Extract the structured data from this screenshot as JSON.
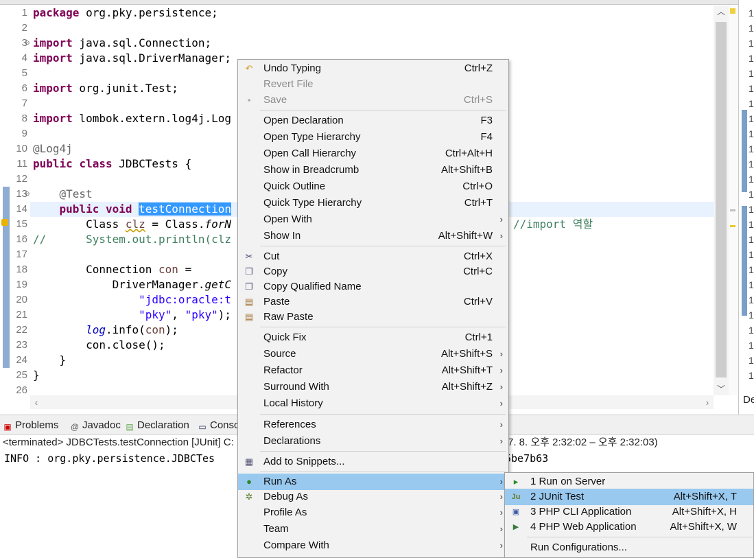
{
  "editor": {
    "line_numbers": [
      "1",
      "2",
      "3",
      "4",
      "5",
      "6",
      "7",
      "8",
      "9",
      "10",
      "11",
      "12",
      "13",
      "14",
      "15",
      "16",
      "17",
      "18",
      "19",
      "20",
      "21",
      "22",
      "23",
      "24",
      "25",
      "26"
    ],
    "code": {
      "l1_kw": "package",
      "l1_rest": " org.pky.persistence;",
      "l3_kw": "import",
      "l3_rest": " java.sql.Connection;",
      "l4_kw": "import",
      "l4_rest": " java.sql.DriverManager;",
      "l6_kw": "import",
      "l6_rest": " org.junit.Test;",
      "l8_kw": "import",
      "l8_rest": " lombok.extern.log4j.Log",
      "l10_ann": "@Log4j",
      "l11_kw1": "public",
      "l11_kw2": "class",
      "l11_rest": " JDBCTests {",
      "l13_ann": "@Test",
      "l14_kw1": "public",
      "l14_kw2": "void",
      "l14_sel": "testConnection",
      "l15_a": "Class ",
      "l15_b": "clz",
      "l15_c": " = Class.",
      "l15_d": "forN",
      "l15_comment": "//import 역할",
      "l16_comment_a": "//",
      "l16_comment_b": "System.out.println(clz",
      "l18_a": "Connection ",
      "l18_b": "con",
      "l18_c": " =",
      "l19_a": "DriverManager.",
      "l19_b": "getC",
      "l20_str": "\"jdbc:oracle:t",
      "l21_str1": "\"pky\"",
      "l21_mid": ", ",
      "l21_str2": "\"pky\"",
      "l21_end": ");",
      "l22_field": "log",
      "l22_mid": ".info(",
      "l22_con": "con",
      "l22_end": ");",
      "l23": "con.close();",
      "l24": "}",
      "l25": "}"
    }
  },
  "right_panel": {
    "numbers": [
      "1",
      "1",
      "1",
      "1",
      "1",
      "1",
      "1",
      "1",
      "1",
      "1",
      "1",
      "1",
      "1",
      "1",
      "1",
      "1",
      "1",
      "1",
      "1",
      "1",
      "1",
      "1",
      "1",
      "1",
      "1"
    ],
    "de_label": "De"
  },
  "bottom": {
    "tabs": [
      {
        "label": "Problems"
      },
      {
        "label": "Javadoc"
      },
      {
        "label": "Declaration"
      },
      {
        "label": "Consc"
      }
    ],
    "terminated": "<terminated> JDBCTests.testConnection [JUnit] C:",
    "time_range": "7. 8. 오후 2:32:02 – 오후 2:32:03)",
    "console_line": "INFO : org.pky.persistence.JDBCTes",
    "console_hash": "5be7b63"
  },
  "context_menu": {
    "items": [
      {
        "label": "Undo Typing",
        "shortcut": "Ctrl+Z"
      },
      {
        "label": "Revert File",
        "shortcut": ""
      },
      {
        "label": "Save",
        "shortcut": "Ctrl+S"
      },
      {
        "label": "Open Declaration",
        "shortcut": "F3"
      },
      {
        "label": "Open Type Hierarchy",
        "shortcut": "F4"
      },
      {
        "label": "Open Call Hierarchy",
        "shortcut": "Ctrl+Alt+H"
      },
      {
        "label": "Show in Breadcrumb",
        "shortcut": "Alt+Shift+B"
      },
      {
        "label": "Quick Outline",
        "shortcut": "Ctrl+O"
      },
      {
        "label": "Quick Type Hierarchy",
        "shortcut": "Ctrl+T"
      },
      {
        "label": "Open With",
        "shortcut": ""
      },
      {
        "label": "Show In",
        "shortcut": "Alt+Shift+W"
      },
      {
        "label": "Cut",
        "shortcut": "Ctrl+X"
      },
      {
        "label": "Copy",
        "shortcut": "Ctrl+C"
      },
      {
        "label": "Copy Qualified Name",
        "shortcut": ""
      },
      {
        "label": "Paste",
        "shortcut": "Ctrl+V"
      },
      {
        "label": "Raw Paste",
        "shortcut": ""
      },
      {
        "label": "Quick Fix",
        "shortcut": "Ctrl+1"
      },
      {
        "label": "Source",
        "shortcut": "Alt+Shift+S"
      },
      {
        "label": "Refactor",
        "shortcut": "Alt+Shift+T"
      },
      {
        "label": "Surround With",
        "shortcut": "Alt+Shift+Z"
      },
      {
        "label": "Local History",
        "shortcut": ""
      },
      {
        "label": "References",
        "shortcut": ""
      },
      {
        "label": "Declarations",
        "shortcut": ""
      },
      {
        "label": "Add to Snippets...",
        "shortcut": ""
      },
      {
        "label": "Run As",
        "shortcut": ""
      },
      {
        "label": "Debug As",
        "shortcut": ""
      },
      {
        "label": "Profile As",
        "shortcut": ""
      },
      {
        "label": "Team",
        "shortcut": ""
      },
      {
        "label": "Compare With",
        "shortcut": ""
      }
    ],
    "submenu_arrow": "›"
  },
  "run_as_submenu": {
    "items": [
      {
        "label": "1 Run on Server",
        "shortcut": ""
      },
      {
        "label": "2 JUnit Test",
        "shortcut": "Alt+Shift+X, T"
      },
      {
        "label": "3 PHP CLI Application",
        "shortcut": "Alt+Shift+X, H"
      },
      {
        "label": "4 PHP Web Application",
        "shortcut": "Alt+Shift+X, W"
      },
      {
        "label": "Run Configurations...",
        "shortcut": ""
      }
    ]
  },
  "colors": {
    "menu_highlight": "#99c9ef",
    "selection": "#3399ff",
    "keyword": "#7f0055",
    "string": "#2a00ff",
    "comment": "#3f7f5f"
  },
  "icons": {
    "undo": "undo-icon",
    "save": "save-icon",
    "cut": "scissors-icon",
    "copy": "copy-icon",
    "paste": "paste-icon",
    "snippets": "snippets-icon",
    "run": "run-icon",
    "debug": "bug-icon",
    "server": "server-icon",
    "junit": "junit-icon",
    "php": "php-icon"
  }
}
